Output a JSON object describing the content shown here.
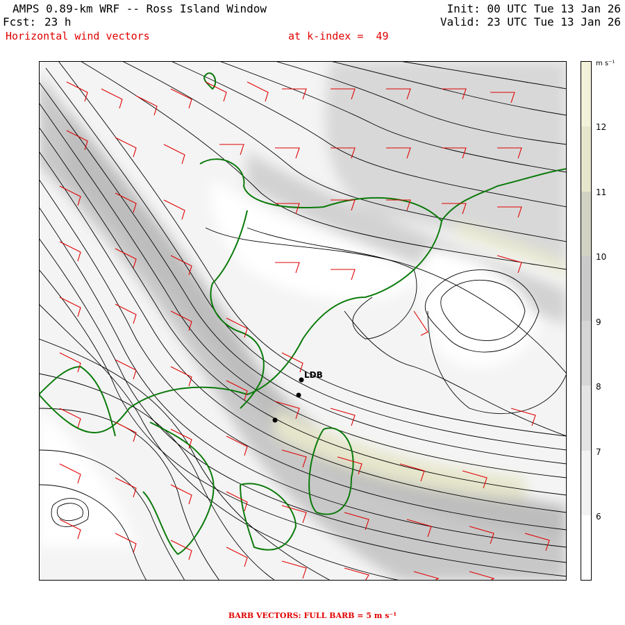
{
  "header": {
    "title": "AMPS 0.89-km WRF -- Ross Island Window",
    "fcst_label": "Fcst:",
    "fcst_value": "23 h",
    "subtitle": "Horizontal wind vectors",
    "kindex": "at k-index =  49",
    "init": "Init: 00 UTC Tue 13 Jan 26",
    "valid": "Valid: 23 UTC Tue 13 Jan 26"
  },
  "colorbar": {
    "units": "m s⁻¹",
    "ticks": [
      "12",
      "11",
      "10",
      "9",
      "8",
      "7",
      "6"
    ],
    "shades": [
      "#ffffff",
      "#f2f2f2",
      "#e4e4e4",
      "#d6d6d6",
      "#cacaca",
      "#d2d2c2",
      "#e6e6cc",
      "#f2f2da"
    ]
  },
  "map": {
    "station_label": "LDB",
    "colors": {
      "contour": "#000000",
      "coastline": "#007a00",
      "barb": "#e00000"
    }
  },
  "footer": {
    "barb_note": "BARB VECTORS:  FULL BARB = 5 m s⁻¹"
  }
}
